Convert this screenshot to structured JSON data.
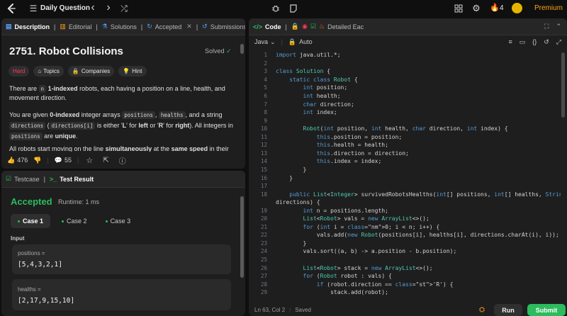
{
  "topbar": {
    "title": "Daily Question",
    "fire_count": "4",
    "premium": "Premium",
    "prev": "‹",
    "next": "›",
    "shuffle": "⤮"
  },
  "desc_tabs": {
    "description": "Description",
    "editorial": "Editorial",
    "solutions": "Solutions",
    "accepted": "Accepted",
    "close": "✕",
    "submissions": "Submissions"
  },
  "problem": {
    "title": "2751. Robot Collisions",
    "status": "Solved",
    "difficulty": "Hard",
    "topics": "Topics",
    "companies": "Companies",
    "hint": "Hint",
    "p1": {
      "a": "There are ",
      "b": "n",
      "c": " ",
      "d": "1-indexed",
      "e": " robots, each having a position on a line, health, and movement direction."
    },
    "p2": {
      "a": "You are given ",
      "b": "0-indexed",
      "c": " integer arrays ",
      "d": "positions",
      ",": ", ",
      "e": "healths",
      "f": ", and a string ",
      "g": "directions",
      "h": " (",
      "i": "directions[i]",
      "j": " is either '",
      "k": "L",
      "l": "' for ",
      "m": "left",
      "n": " or '",
      "o": "R",
      "p": "' for ",
      "q": "right",
      "r": "). All integers in ",
      "s": "positions",
      "t": " are ",
      "u": "unique",
      "v": "."
    },
    "p3": {
      "a": "All robots start moving on the line ",
      "b": "simultaneously",
      "c": " at the ",
      "d": "same speed",
      "e": " in their"
    },
    "likes": "476",
    "comments": "55"
  },
  "bottom": {
    "testcase_tab": "Testcase",
    "result_tab": "Test Result",
    "verdict": "Accepted",
    "runtime": "Runtime: 1 ms",
    "cases": [
      "Case 1",
      "Case 2",
      "Case 3"
    ],
    "input_label": "Input",
    "positions_label": "positions =",
    "positions_value": "[5,4,3,2,1]",
    "healths_label": "healths =",
    "healths_value": "[2,17,9,15,10]"
  },
  "code_tabs": {
    "code": "Code",
    "detailed": "Detailed Eac",
    "lang": "Java",
    "mode": "Auto"
  },
  "status": {
    "cursor": "Ln 63, Col 2",
    "saved": "Saved"
  },
  "buttons": {
    "run": "Run",
    "submit": "Submit"
  },
  "colors": {
    "accepted": "#2cbb5d",
    "hard": "#ff375f",
    "solved": "#2cbb5d",
    "premium": "#ffa116",
    "submit_bg": "#2cbb5d"
  },
  "code_lines": [
    {
      "n": "1",
      "t": "import java.util.*;"
    },
    {
      "n": "2",
      "t": ""
    },
    {
      "n": "3",
      "t": "class Solution {"
    },
    {
      "n": "4",
      "t": "    static class Robot {"
    },
    {
      "n": "5",
      "t": "        int position;"
    },
    {
      "n": "6",
      "t": "        int health;"
    },
    {
      "n": "7",
      "t": "        char direction;"
    },
    {
      "n": "8",
      "t": "        int index;"
    },
    {
      "n": "9",
      "t": ""
    },
    {
      "n": "10",
      "t": "        Robot(int position, int health, char direction, int index) {"
    },
    {
      "n": "11",
      "t": "            this.position = position;"
    },
    {
      "n": "12",
      "t": "            this.health = health;"
    },
    {
      "n": "13",
      "t": "            this.direction = direction;"
    },
    {
      "n": "14",
      "t": "            this.index = index;"
    },
    {
      "n": "15",
      "t": "        }"
    },
    {
      "n": "16",
      "t": "    }"
    },
    {
      "n": "17",
      "t": ""
    },
    {
      "n": "18",
      "t": "    public List<Integer> survivedRobotsHealths(int[] positions, int[] healths, String"
    },
    {
      "n": "",
      "t": "directions) {"
    },
    {
      "n": "19",
      "t": "        int n = positions.length;"
    },
    {
      "n": "20",
      "t": "        List<Robot> vals = new ArrayList<>();"
    },
    {
      "n": "21",
      "t": "        for (int i = 0; i < n; i++) {"
    },
    {
      "n": "22",
      "t": "            vals.add(new Robot(positions[i], healths[i], directions.charAt(i), i));"
    },
    {
      "n": "23",
      "t": "        }"
    },
    {
      "n": "24",
      "t": "        vals.sort((a, b) -> a.position - b.position);"
    },
    {
      "n": "25",
      "t": ""
    },
    {
      "n": "26",
      "t": "        List<Robot> stack = new ArrayList<>();"
    },
    {
      "n": "27",
      "t": "        for (Robot robot : vals) {"
    },
    {
      "n": "28",
      "t": "            if (robot.direction == 'R') {"
    },
    {
      "n": "29",
      "t": "                stack.add(robot);"
    }
  ]
}
